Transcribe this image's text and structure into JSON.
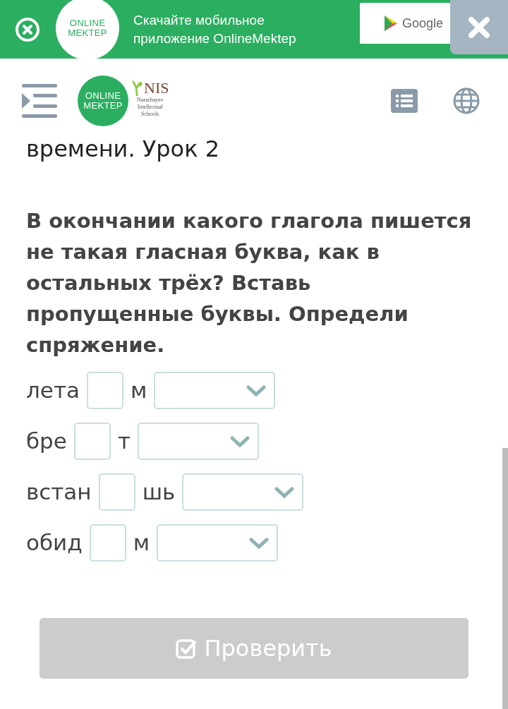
{
  "app_banner": {
    "logo_lines": [
      "ONLINE",
      "MEKTEP"
    ],
    "message": "Скачайте мобильное приложение OnlineMektep",
    "store_button": "Google"
  },
  "header": {
    "logo_lines": [
      "ONLINE",
      "MEKTEP"
    ],
    "partner_logo": {
      "mark": "NIS",
      "lines": [
        "Nazarbayev",
        "Intellectual",
        "Schools"
      ]
    }
  },
  "lesson_title": "времени. Урок 2",
  "question": "В окончании какого глагола пишется не такая гласная буква, как в остальных трёх? Вставь пропущенные буквы. Определи спряжение.",
  "rows": [
    {
      "stem": "лета",
      "ending": "м"
    },
    {
      "stem": "бре",
      "ending": "т"
    },
    {
      "stem": "встан",
      "ending": "шь"
    },
    {
      "stem": "обид",
      "ending": "м"
    }
  ],
  "check_button": {
    "label": "Проверить",
    "disabled": true
  }
}
